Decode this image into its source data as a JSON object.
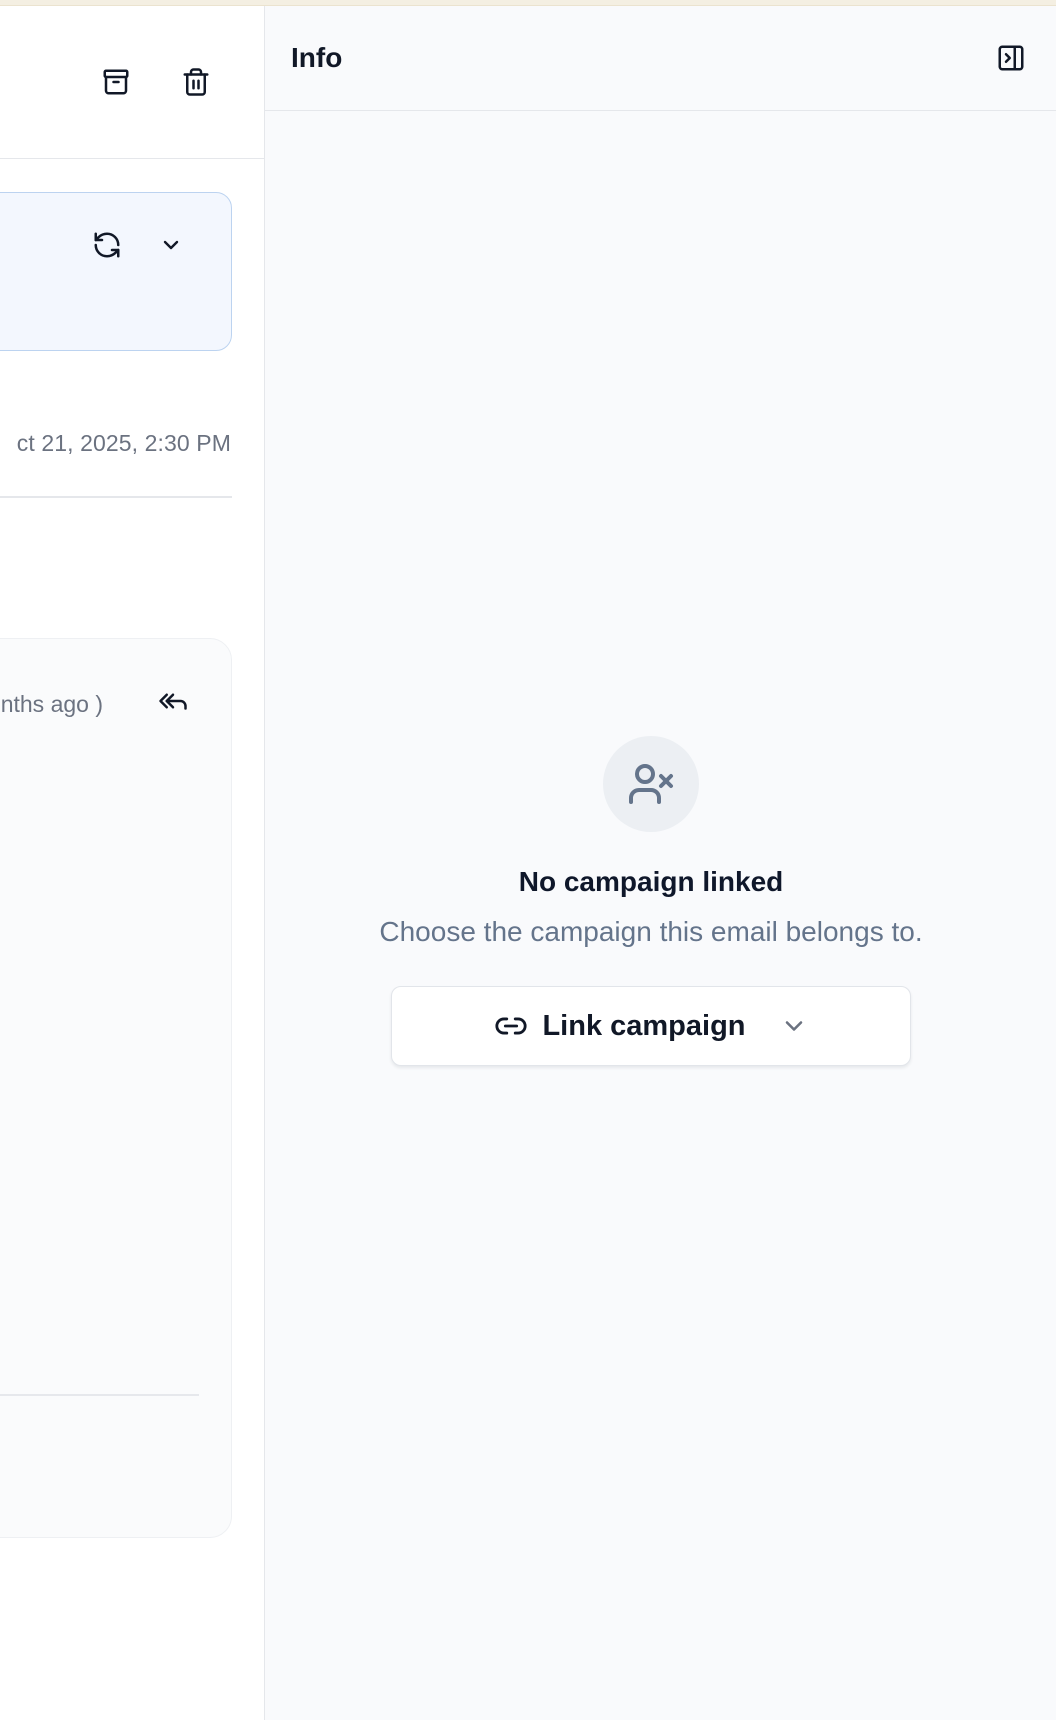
{
  "toolbar": {
    "archive_icon": "archive-icon",
    "trash_icon": "trash-icon"
  },
  "thread": {
    "refresh_icon": "refresh-icon",
    "expand_icon": "chevron-down-icon"
  },
  "meta": {
    "date": "ct 21, 2025, 2:30 PM"
  },
  "message": {
    "relative_time": "nonths ago )",
    "reply_all_icon": "reply-all-icon"
  },
  "info_panel": {
    "title": "Info",
    "toggle_icon": "panel-right-close-icon",
    "empty_state": {
      "icon": "user-x-icon",
      "title": "No campaign linked",
      "description": "Choose the campaign this email belongs to.",
      "button_label": "Link campaign",
      "button_icon": "link-icon",
      "button_chevron": "chevron-down-icon"
    }
  },
  "colors": {
    "panel_bg": "#f9fafc",
    "thread_card_bg": "#f3f7fe",
    "thread_card_border": "#bcd3f0",
    "muted_text": "#6b7280",
    "empty_icon_bg": "#eceff3"
  }
}
